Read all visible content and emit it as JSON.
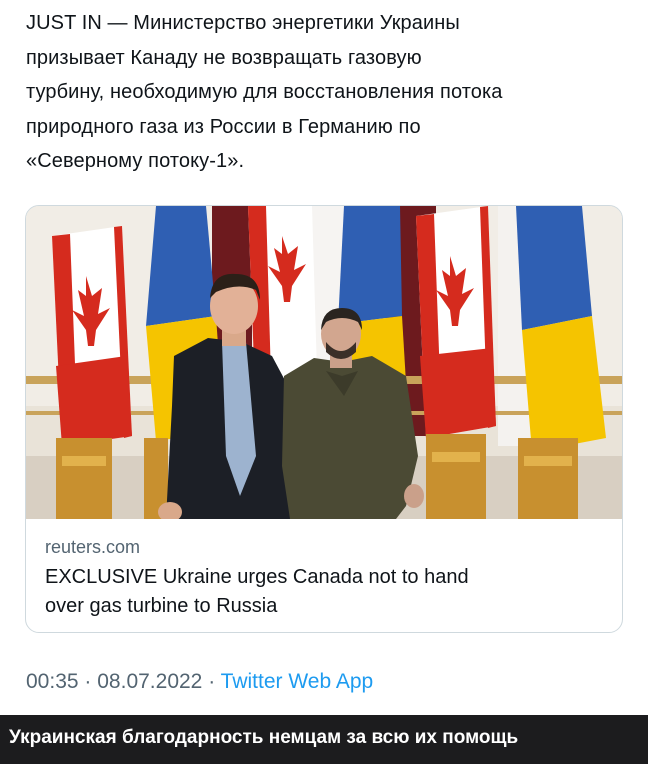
{
  "tweet": {
    "lines": [
      "JUST IN — Министерство энергетики Украины",
      "призывает Канаду не возвращать газовую",
      "турбину, необходимую для восстановления потока",
      "природного газа из России в Германию по",
      "«Северному потоку-1»."
    ]
  },
  "card": {
    "image": "photo-leaders-with-canada-and-ukraine-flags",
    "domain": "reuters.com",
    "title_lines": [
      "EXCLUSIVE Ukraine urges Canada not to hand",
      "over gas turbine to Russia"
    ]
  },
  "meta": {
    "time": "00:35",
    "separator": "·",
    "date": "08.07.2022",
    "app": "Twitter Web App"
  },
  "caption": {
    "text": "Украинская благодарность немцам за всю их помощь"
  },
  "colors": {
    "text": "#0f1419",
    "secondary": "#536471",
    "link": "#1d9bf0",
    "caption_bg": "#1c1c1e",
    "flag_red": "#d52b1e",
    "flag_blue": "#2f5fb3",
    "flag_yellow": "#f5c400"
  }
}
